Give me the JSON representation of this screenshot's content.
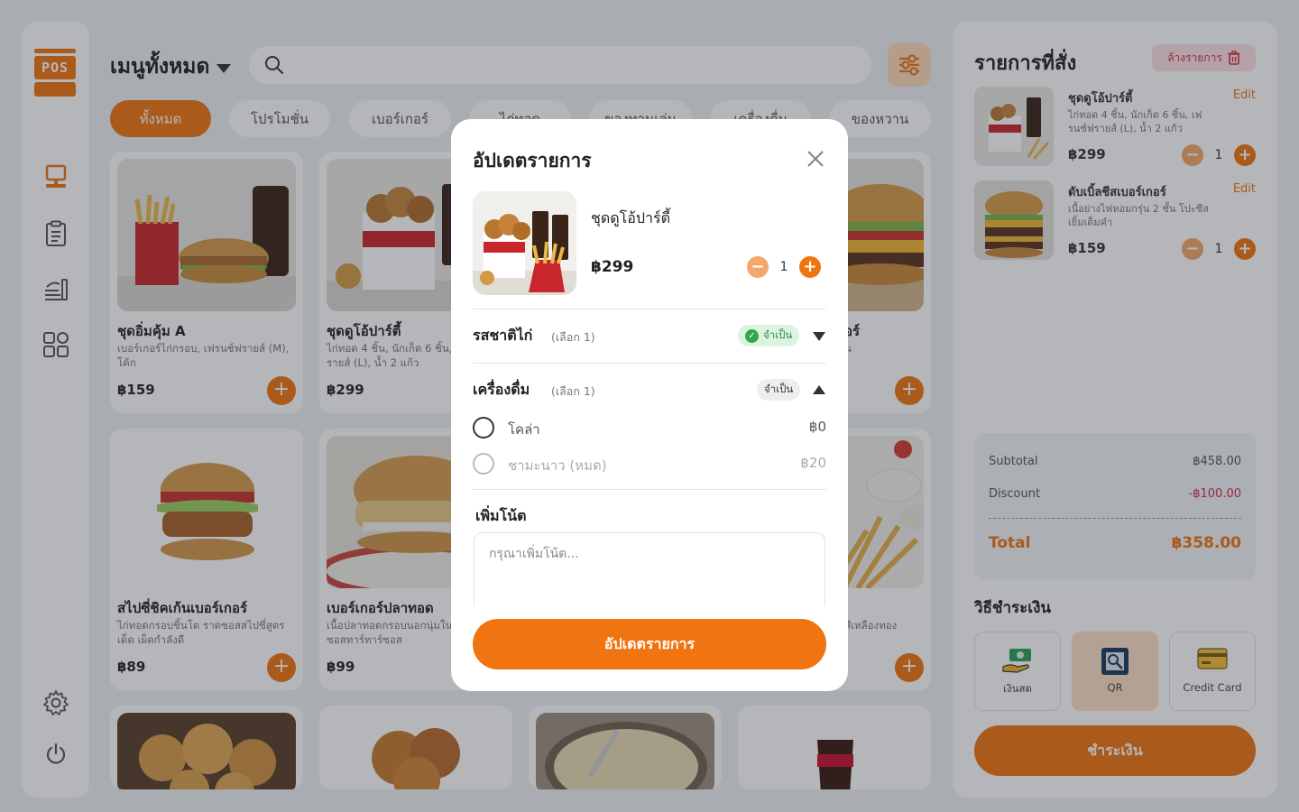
{
  "sidebar": {
    "logo_text": "POS",
    "icons": [
      "pos-terminal-icon",
      "clipboard-icon",
      "food-stack-icon",
      "grid-icon",
      "settings-gear-icon",
      "power-icon"
    ]
  },
  "main": {
    "title": "เมนูทั้งหมด",
    "search_placeholder": "",
    "categories": [
      "ทั้งหมด",
      "โปรโมชั่น",
      "เบอร์เกอร์",
      "ไก่ทอด",
      "ของทานเล่น",
      "เครื่องดื่ม",
      "ของหวาน"
    ],
    "active_category": "ทั้งหมด",
    "products": [
      {
        "name": "ชุดอิ่มคุ้ม A",
        "desc": "เบอร์เกอร์ไก่กรอบ, เฟรนช์ฟรายส์ (M), โค้ก",
        "price": "฿159"
      },
      {
        "name": "ชุดดูโอ้ปาร์ตี้",
        "desc": "ไก่ทอด 4 ชิ้น, นักเก็ต 6 ชิ้น, เฟรนช์ฟรายส์ (L), น้ำ 2 แก้ว",
        "price": "฿299"
      },
      {
        "name": "ดับเบิ้ลชีสเบอร์เกอร์",
        "desc": "",
        "name_fragment": "อร์",
        "desc_fragment": "น",
        "price": ""
      },
      {
        "name": "สไปซี่ชิคเก้นเบอร์เกอร์",
        "desc": "ไก่ทอดกรอบชิ้นโต ราดซอสสไปซี่สูตรเด็ด เผ็ดกำลังดี",
        "price": "฿89"
      },
      {
        "name": "เบอร์เกอร์ปลาทอด",
        "desc": "เนื้อปลาทอดกรอบนอกนุ่มใน เสิร์ฟพร้อมซอสทาร์ทาร์ซอส",
        "price": "฿99"
      },
      {
        "name": "",
        "desc_fragment": "สีเหลืองทอง",
        "price": ""
      }
    ]
  },
  "order": {
    "title": "รายการที่สั่ง",
    "clear_label": "ล้างรายการ",
    "items": [
      {
        "name": "ชุดดูโอ้ปาร์ตี้",
        "edit": "Edit",
        "desc": "ไก่ทอด 4 ชิ้น, นักเก็ต 6 ชิ้น, เฟรนช์ฟรายส์ (L), น้ำ 2 แก้ว",
        "price": "฿299",
        "qty": "1"
      },
      {
        "name": "ดับเบิ้ลชีสเบอร์เกอร์",
        "edit": "Edit",
        "desc": "เนื้อย่างไฟหอมกรุ่น 2 ชั้น โปะชีสเยิ้มเต็มคำ",
        "price": "฿159",
        "qty": "1"
      }
    ],
    "summary": {
      "subtotal_label": "Subtotal",
      "subtotal": "฿458.00",
      "discount_label": "Discount",
      "discount": "-฿100.00",
      "total_label": "Total",
      "total": "฿358.00"
    },
    "payment_title": "วิธีชำระเงิน",
    "payment_methods": [
      {
        "label": "เงินสด",
        "icon": "cash-hand-icon"
      },
      {
        "label": "QR",
        "icon": "qr-scan-icon",
        "selected": true
      },
      {
        "label": "Credit Card",
        "icon": "credit-card-icon"
      }
    ],
    "pay_button": "ชำระเงิน"
  },
  "modal": {
    "title": "อัปเดตรายการ",
    "product_name": "ชุดดูโอ้ปาร์ตี้",
    "price": "฿299",
    "qty": "1",
    "options": [
      {
        "title": "รสชาติไก่",
        "sub": "(เลือก 1)",
        "badge": "จำเป็น",
        "satisfied": true,
        "expanded": false
      },
      {
        "title": "เครื่องดื่ม",
        "sub": "(เลือก 1)",
        "badge": "จำเป็น",
        "satisfied": false,
        "expanded": true,
        "choices": [
          {
            "label": "โคล่า",
            "price": "฿0",
            "disabled": false
          },
          {
            "label": "ชามะนาว (หมด)",
            "price": "฿20",
            "disabled": true
          }
        ]
      }
    ],
    "note_label": "เพิ่มโน้ต",
    "note_placeholder": "กรุณาเพิ่มโน้ต...",
    "submit": "อัปเดตรายการ"
  },
  "colors": {
    "accent": "#f07410",
    "danger": "#d62b45",
    "success": "#2ea84a"
  }
}
